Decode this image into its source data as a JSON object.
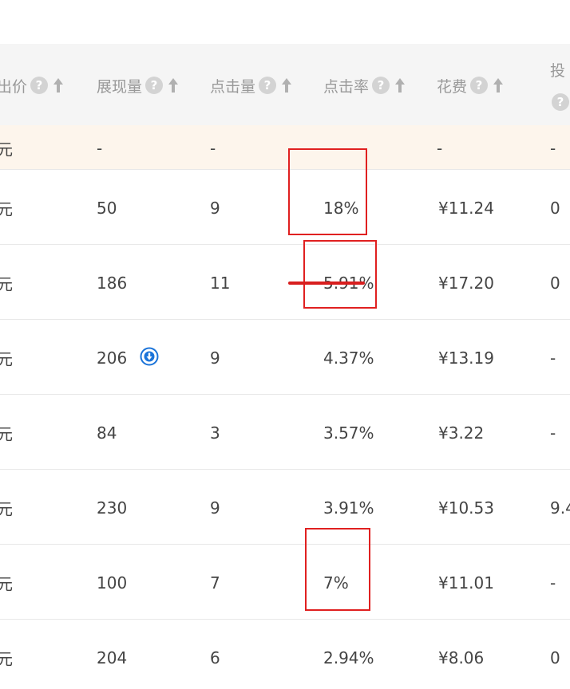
{
  "table": {
    "columns": [
      {
        "key": "bid",
        "label": "出价",
        "help_icon": "question-circle-icon",
        "sort_icon": "arrow-up-icon"
      },
      {
        "key": "impressions",
        "label": "展现量",
        "help_icon": "question-circle-icon",
        "sort_icon": "arrow-up-icon"
      },
      {
        "key": "clicks",
        "label": "点击量",
        "help_icon": "question-circle-icon",
        "sort_icon": "arrow-up-icon"
      },
      {
        "key": "ctr",
        "label": "点击率",
        "help_icon": "question-circle-icon",
        "sort_icon": "arrow-up-icon"
      },
      {
        "key": "cost",
        "label": "花费",
        "help_icon": "question-circle-icon",
        "sort_icon": "arrow-up-icon"
      },
      {
        "key": "roi",
        "label": "投",
        "help_icon": "question-circle-icon"
      }
    ],
    "summary_row": {
      "bid": "元",
      "impressions": "-",
      "clicks": "-",
      "ctr": "-",
      "cost": "-",
      "roi": "-"
    },
    "rows": [
      {
        "bid": "元",
        "impressions": "50",
        "clicks": "9",
        "ctr": "18%",
        "cost": "¥11.24",
        "roi": "0"
      },
      {
        "bid": "元",
        "impressions": "186",
        "clicks": "11",
        "ctr": "5.91%",
        "cost": "¥17.20",
        "roi": "0"
      },
      {
        "bid": "元",
        "impressions": "206",
        "impressions_icon": "download-circle-icon",
        "clicks": "9",
        "ctr": "4.37%",
        "cost": "¥13.19",
        "roi": "-"
      },
      {
        "bid": "元",
        "impressions": "84",
        "clicks": "3",
        "ctr": "3.57%",
        "cost": "¥3.22",
        "roi": "-"
      },
      {
        "bid": "元",
        "impressions": "230",
        "clicks": "9",
        "ctr": "3.91%",
        "cost": "¥10.53",
        "roi": "9.4"
      },
      {
        "bid": "元",
        "impressions": "100",
        "clicks": "7",
        "ctr": "7%",
        "cost": "¥11.01",
        "roi": "-"
      },
      {
        "bid": "元",
        "impressions": "204",
        "clicks": "6",
        "ctr": "2.94%",
        "cost": "¥8.06",
        "roi": "0"
      }
    ]
  },
  "annotations": {
    "color": "#e02020",
    "highlighted_values": [
      "18%",
      "5.91%",
      "7%"
    ],
    "struck_value": "5.91%"
  },
  "colors": {
    "header_bg": "#f5f5f5",
    "summary_bg": "#fdf5ec",
    "icon_blue": "#1a73d9",
    "help_icon": "#d3d3d3"
  }
}
